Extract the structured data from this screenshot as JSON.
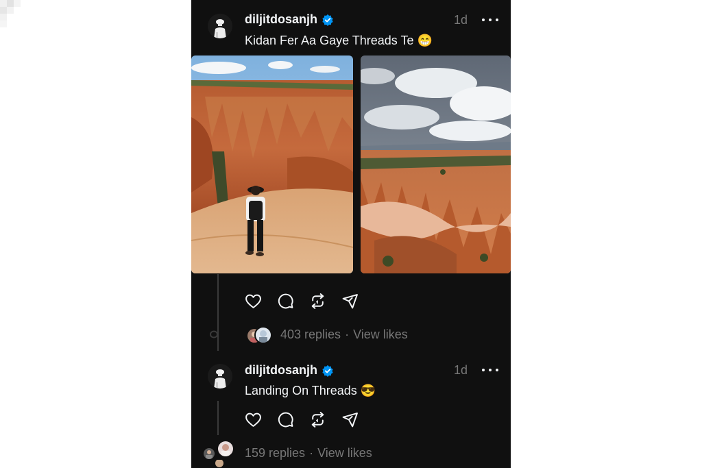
{
  "posts": [
    {
      "username": "diljitdosanjh",
      "time": "1d",
      "caption": "Kidan Fer Aa Gaye Threads Te 😁",
      "stats": {
        "replies": "403 replies",
        "separator": "·",
        "likes": "View likes"
      }
    },
    {
      "username": "diljitdosanjh",
      "time": "1d",
      "caption": "Landing On Threads 😎",
      "stats": {
        "replies": "159 replies",
        "separator": "·",
        "likes": "View likes"
      }
    }
  ],
  "icons": {
    "verified": "verified-badge-icon",
    "more": "more-options-icon",
    "like": "heart-icon",
    "reply": "comment-icon",
    "repost": "repost-icon",
    "share": "send-icon"
  },
  "colors": {
    "background": "#101010",
    "text": "#f3f5f7",
    "muted": "#777777",
    "verified": "#0095f6"
  }
}
